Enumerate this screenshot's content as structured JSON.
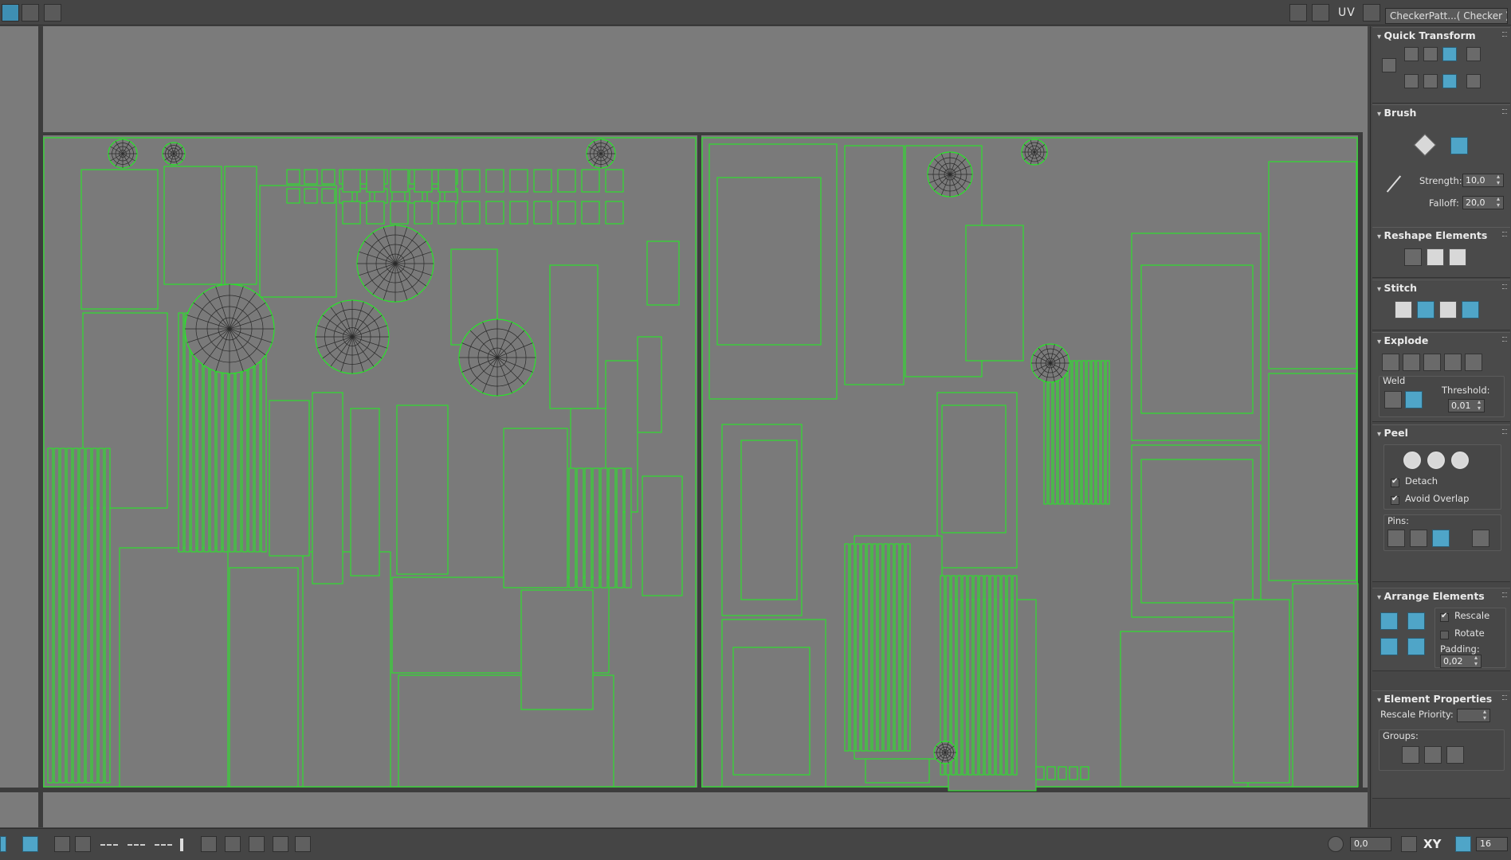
{
  "top_toolbar": {
    "uv_label": "UV",
    "texture_selector": "CheckerPatt...( Checker )"
  },
  "panel": {
    "quick_transform": {
      "title": "Quick Transform"
    },
    "brush": {
      "title": "Brush",
      "strength_label": "Strength:",
      "strength_value": "10,0",
      "falloff_label": "Falloff:",
      "falloff_value": "20,0"
    },
    "reshape_elements": {
      "title": "Reshape Elements"
    },
    "stitch": {
      "title": "Stitch"
    },
    "explode": {
      "title": "Explode",
      "weld_label": "Weld",
      "threshold_label": "Threshold:",
      "threshold_value": "0,01"
    },
    "peel": {
      "title": "Peel",
      "detach_label": "Detach",
      "avoid_overlap_label": "Avoid Overlap",
      "pins_label": "Pins:"
    },
    "arrange_elements": {
      "title": "Arrange Elements",
      "rescale_label": "Rescale",
      "rotate_label": "Rotate",
      "padding_label": "Padding:",
      "padding_value": "0,02"
    },
    "element_properties": {
      "title": "Element Properties",
      "rescale_priority_label": "Rescale Priority:",
      "groups_label": "Groups:"
    }
  },
  "bottom_toolbar": {
    "u_value": "0,0",
    "xy_label": "XY",
    "grid_value": "16"
  },
  "colors": {
    "uv_wire": "#27e627",
    "viewport_bg": "#7b7b7b",
    "accent_blue": "#4fa5c8"
  }
}
